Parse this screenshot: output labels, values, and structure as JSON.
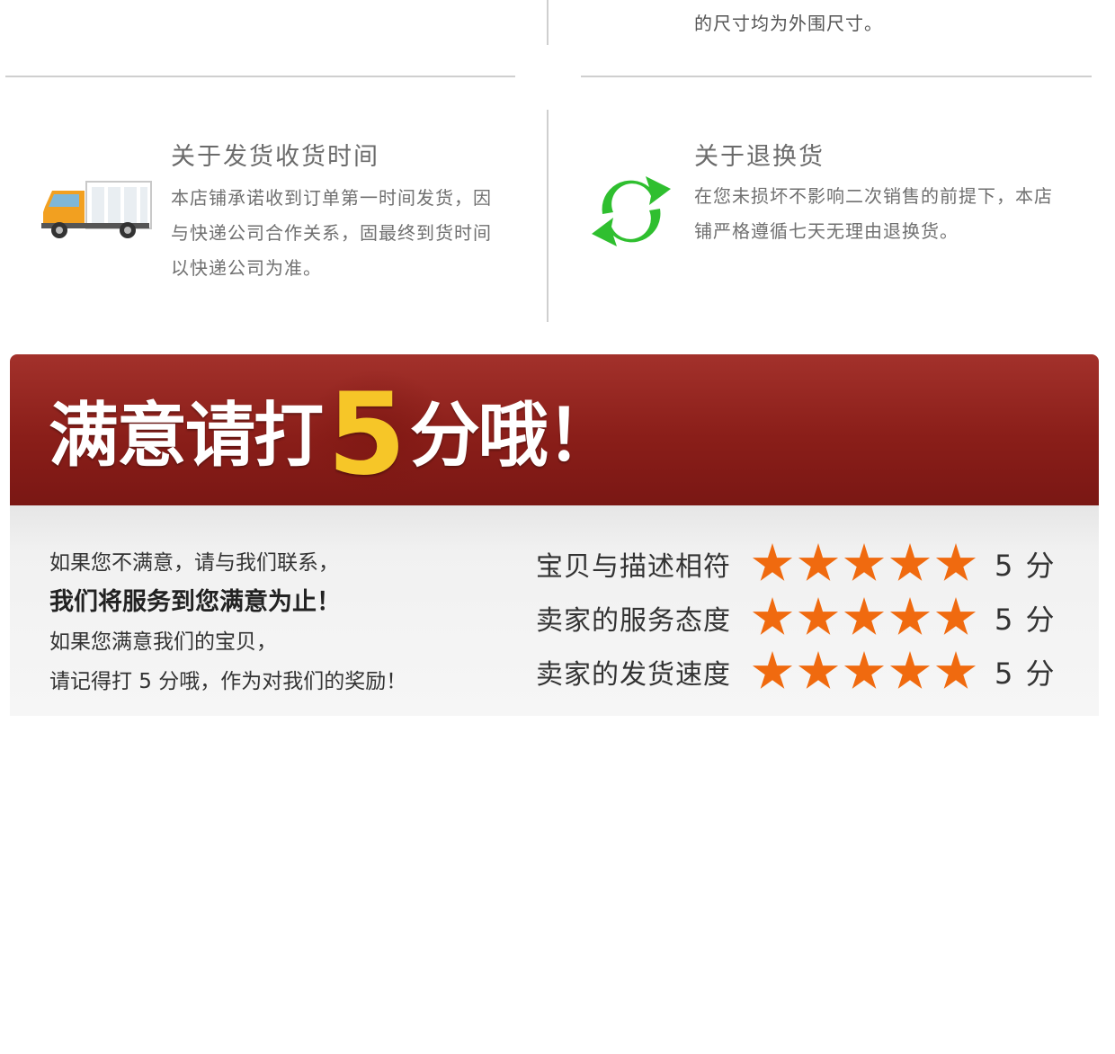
{
  "top_fragment": {
    "note": "的尺寸均为外围尺寸。"
  },
  "info_blocks": [
    {
      "title": "关于发货收货时间",
      "lines": [
        "本店铺承诺收到订单第一时间发货，因",
        "与快递公司合作关系，固最终到货时间",
        "以快递公司为准。"
      ],
      "icon": "delivery-truck-icon"
    },
    {
      "title": "关于退换货",
      "lines": [
        "在您未损坏不影响二次销售的前提下，本店",
        "铺严格遵循七天无理由退换货。"
      ],
      "icon": "exchange-arrows-icon"
    }
  ],
  "banner": {
    "headline_before": "满意请打",
    "headline_number": "5",
    "headline_after": "分哦！"
  },
  "feedback": {
    "line1": "如果您不满意，请与我们联系，",
    "line2": "我们将服务到您满意为止！",
    "line3": "如果您满意我们的宝贝，",
    "line4": "请记得打 5 分哦，作为对我们的奖励！"
  },
  "ratings": [
    {
      "label": "宝贝与描述相符",
      "stars": 5,
      "score": "5 分"
    },
    {
      "label": "卖家的服务态度",
      "stars": 5,
      "score": "5 分"
    },
    {
      "label": "卖家的发货速度",
      "stars": 5,
      "score": "5 分"
    }
  ],
  "colors": {
    "banner_red": "#8a1e19",
    "highlight_yellow": "#f6c628",
    "star_orange": "#f06a0f",
    "icon_green": "#2fbf2f",
    "truck_orange": "#f2a020"
  }
}
